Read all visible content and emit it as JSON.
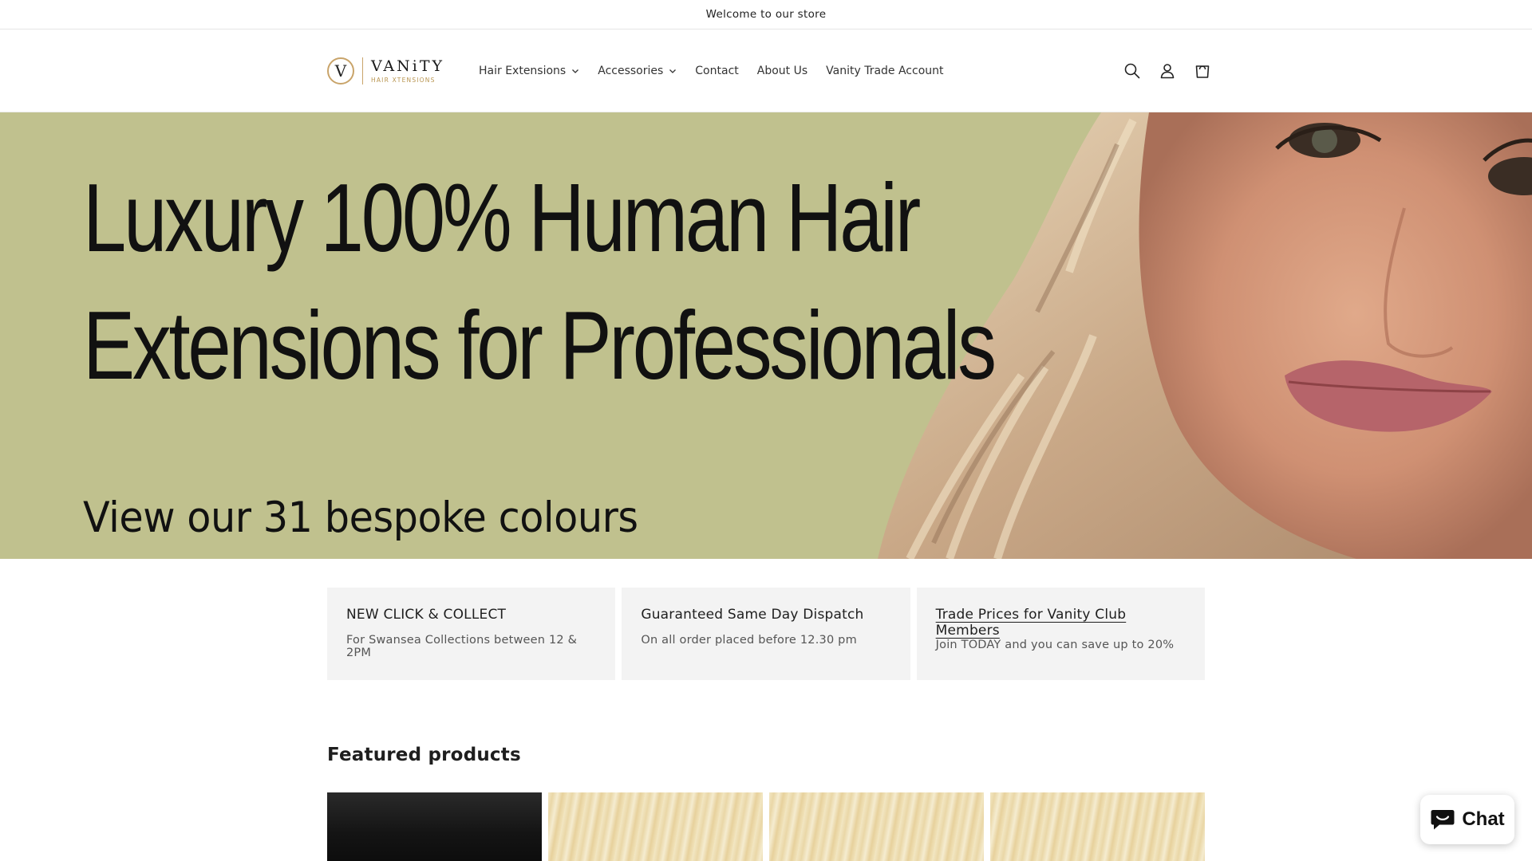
{
  "announcement": {
    "text": "Welcome to our store"
  },
  "logo": {
    "mark": "V",
    "word": "VANiTY",
    "sub": "HAIR XTENSIONS"
  },
  "nav": {
    "items": [
      {
        "label": "Hair Extensions",
        "dropdown": true
      },
      {
        "label": "Accessories",
        "dropdown": true
      },
      {
        "label": "Contact",
        "dropdown": false
      },
      {
        "label": "About Us",
        "dropdown": false
      },
      {
        "label": "Vanity Trade Account",
        "dropdown": false
      }
    ]
  },
  "header_icons": [
    "search-icon",
    "account-icon",
    "cart-icon"
  ],
  "hero": {
    "line1": "Luxury 100% Human Hair",
    "line2": "Extensions for Professionals",
    "sub": "View our 31 bespoke colours",
    "background_color": "#c0c18e"
  },
  "features": [
    {
      "title": "NEW CLICK & COLLECT",
      "text": "For Swansea Collections between 12 & 2PM",
      "link": false
    },
    {
      "title": "Guaranteed Same Day Dispatch",
      "text": "On all order placed before 12.30 pm",
      "link": false
    },
    {
      "title": "Trade Prices for Vanity Club Members",
      "text": "Join TODAY and you can save up to 20%",
      "link": true
    }
  ],
  "featured": {
    "title": "Featured products"
  },
  "chat": {
    "label": "Chat",
    "icon": "chat-bubble-icon"
  },
  "colors": {
    "accent_gold": "#c9a46a",
    "hero_bg": "#c0c18e",
    "feature_bg": "#f3f3f3"
  }
}
